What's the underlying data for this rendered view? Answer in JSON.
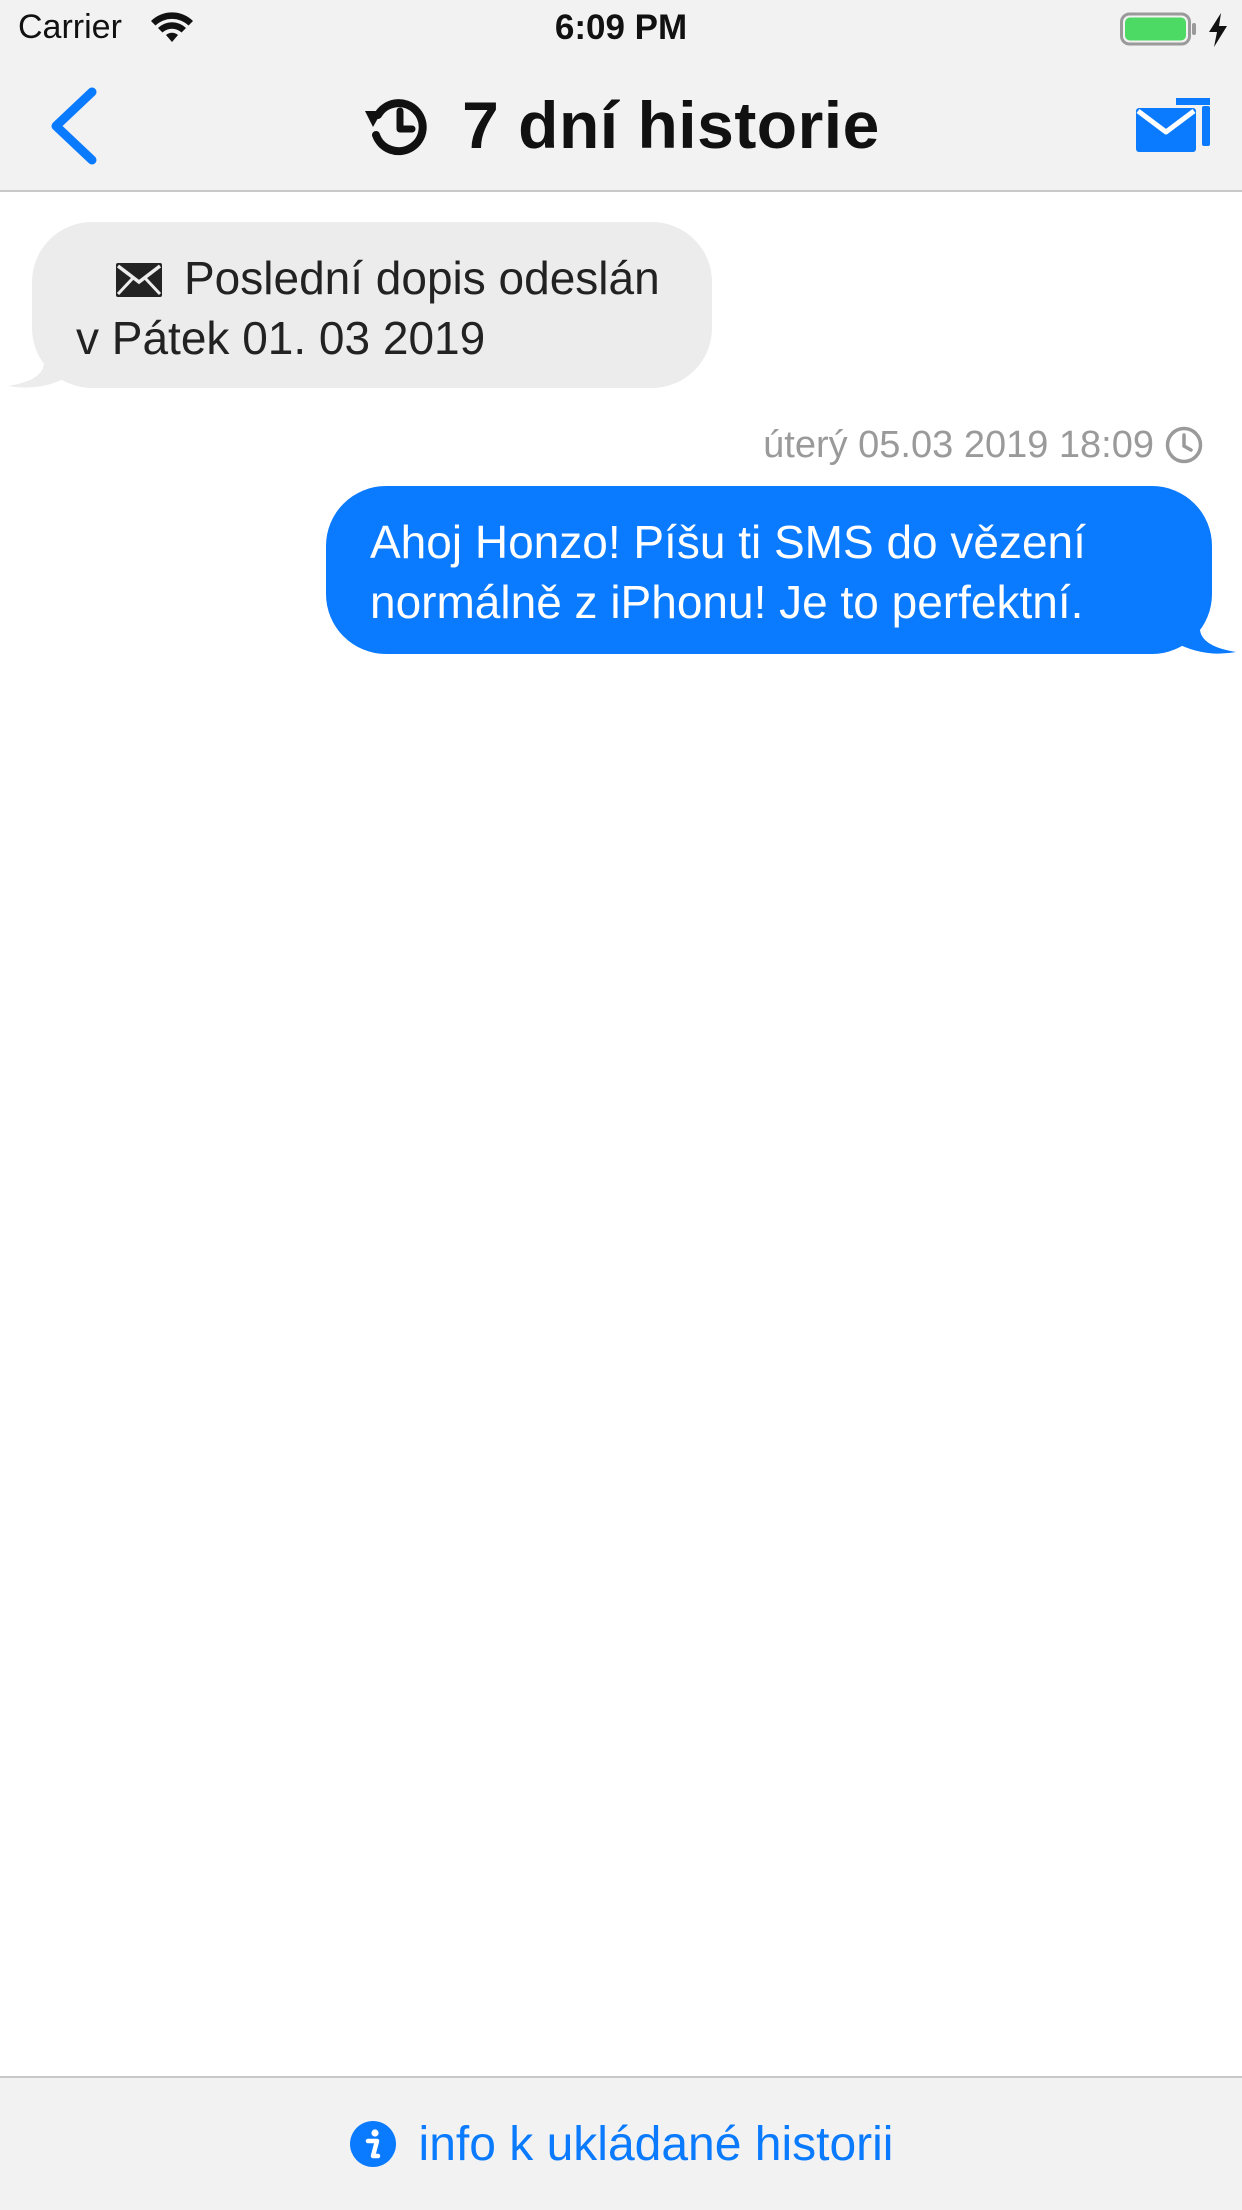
{
  "status_bar": {
    "carrier": "Carrier",
    "time": "6:09 PM",
    "icons": [
      "wifi-icon",
      "battery-icon",
      "charging-bolt-icon"
    ],
    "battery_color": "#4cd964"
  },
  "nav_bar": {
    "title": "7 dní historie",
    "title_icon": "history-icon",
    "left_button_icon": "chevron-left-icon",
    "right_button_icon": "mail-send-icon",
    "accent_color": "#0a7aff"
  },
  "messages": {
    "incoming": {
      "icon": "envelope-icon",
      "line1": "Poslední dopis odeslán",
      "line2": "v Pátek 01. 03 2019",
      "bubble_color": "#ececec"
    },
    "timestamp": "úterý 05.03 2019 18:09",
    "timestamp_icon": "clock-icon",
    "outgoing": {
      "line1": "Ahoj Honzo! Píšu ti SMS do vězení",
      "line2": "normálně z iPhonu! Je to perfektní.",
      "bubble_color": "#0a7aff"
    }
  },
  "bottom_bar": {
    "icon": "info-icon",
    "label": "info k ukládané historii"
  }
}
